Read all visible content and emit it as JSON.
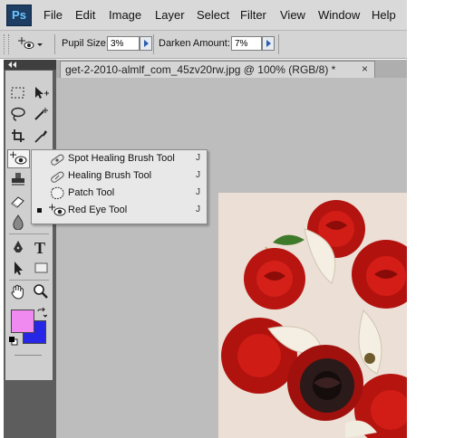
{
  "app": {
    "logo": "Ps"
  },
  "menu": [
    "File",
    "Edit",
    "Image",
    "Layer",
    "Select",
    "Filter",
    "View",
    "Window",
    "Help"
  ],
  "options": {
    "pupil_label": "Pupil Size:",
    "pupil_value": "3%",
    "darken_label": "Darken Amount:",
    "darken_value": "7%"
  },
  "document": {
    "tab_title": "get-2-2010-almlf_com_45zv20rw.jpg @ 100% (RGB/8) *",
    "close": "×"
  },
  "flyout": {
    "items": [
      {
        "label": "Spot Healing Brush Tool",
        "shortcut": "J",
        "icon": "spot-healing-brush-icon",
        "selected": false
      },
      {
        "label": "Healing Brush Tool",
        "shortcut": "J",
        "icon": "healing-brush-icon",
        "selected": false
      },
      {
        "label": "Patch Tool",
        "shortcut": "J",
        "icon": "patch-icon",
        "selected": false
      },
      {
        "label": "Red Eye Tool",
        "shortcut": "J",
        "icon": "red-eye-icon",
        "selected": true
      }
    ]
  },
  "colors": {
    "foreground": "#f08af0",
    "background": "#2626e6"
  },
  "tools": [
    "marquee-icon",
    "move-icon",
    "lasso-icon",
    "magic-wand-icon",
    "crop-icon",
    "eyedropper-icon",
    "red-eye-tool-icon",
    "stamp-icon",
    "brush-icon",
    "eraser-icon",
    "blur-icon",
    "pen-icon",
    "type-icon",
    "path-select-icon",
    "rectangle-icon",
    "hand-icon",
    "zoom-icon",
    "swap-colors-icon",
    "default-colors-icon"
  ]
}
